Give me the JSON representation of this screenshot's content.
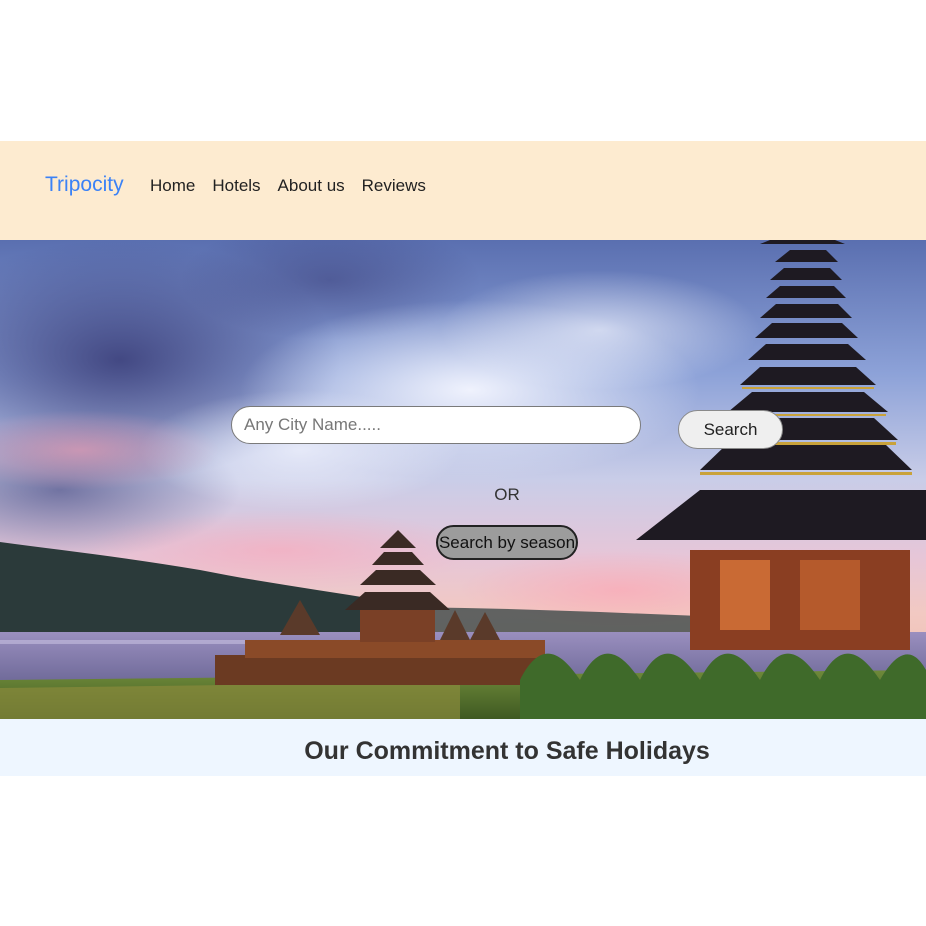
{
  "navbar": {
    "brand": "Tripocity",
    "links": [
      "Home",
      "Hotels",
      "About us",
      "Reviews"
    ]
  },
  "hero": {
    "search": {
      "placeholder": "Any City Name.....",
      "value": "",
      "button_label": "Search"
    },
    "or_label": "OR",
    "season_button_label": "Search by season"
  },
  "commitment": {
    "title": "Our Commitment to Safe Holidays"
  },
  "colors": {
    "navbar_bg": "#fdebd0",
    "brand": "#3b82f6",
    "commit_bg": "#eef6ff"
  }
}
